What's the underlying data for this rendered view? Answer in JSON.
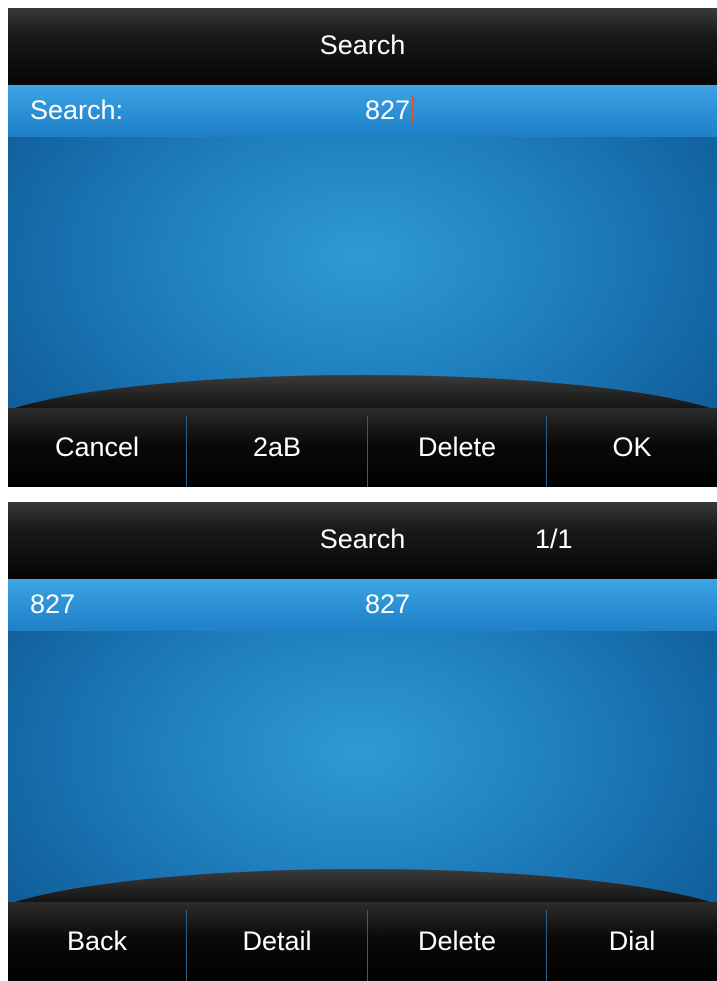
{
  "screen1": {
    "title": "Search",
    "search_label": "Search:",
    "search_value": "827",
    "softkeys": [
      "Cancel",
      "2aB",
      "Delete",
      "OK"
    ]
  },
  "screen2": {
    "title": "Search",
    "page_indicator": "1/1",
    "result": {
      "name": "827",
      "number": "827"
    },
    "softkeys": [
      "Back",
      "Detail",
      "Delete",
      "Dial"
    ]
  }
}
